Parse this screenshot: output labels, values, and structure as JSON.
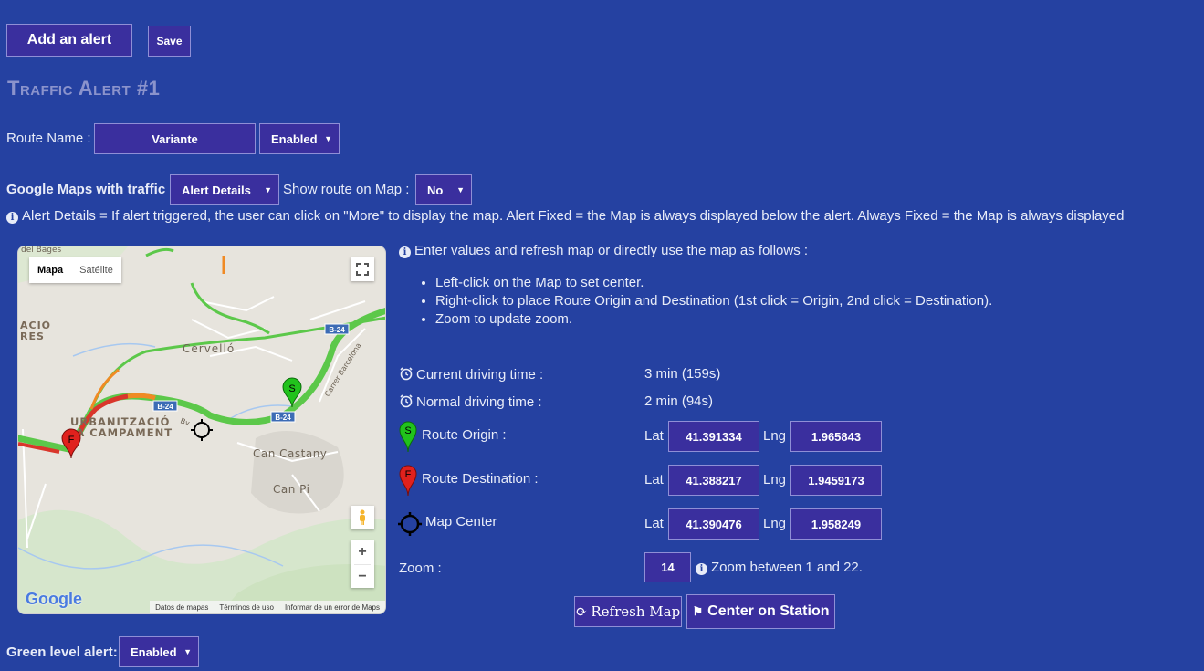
{
  "toolbar": {
    "add_alert_label": "Add an alert",
    "save_label": "Save"
  },
  "alert": {
    "title": "Traffic Alert #1",
    "route_name_label": "Route Name :",
    "route_name_value": "Variante",
    "route_status": "Enabled",
    "maps_label": "Google Maps with traffic :",
    "maps_mode": "Alert Details",
    "show_route_label": "Show route on Map :",
    "show_route_value": "No",
    "maps_info": "Alert Details = If alert triggered, the user can click on \"More\" to display the map. Alert Fixed = the Map is always displayed below the alert. Always Fixed = the Map is always displayed"
  },
  "map": {
    "type_map": "Mapa",
    "type_satellite": "Satélite",
    "place_labels": [
      "Cervelló",
      "URBANITZACIÓ",
      "LA CAMPAMENT",
      "Can Castany",
      "Can Pi",
      "ACIÓ",
      "RES",
      "del Bages",
      "Carrer Barcelona",
      "Bv"
    ],
    "road_badges": [
      "B-24",
      "B-24",
      "B-24"
    ],
    "footer": [
      "Datos de mapas",
      "Términos de uso",
      "Informar de un error de Maps"
    ],
    "brand": "Google",
    "zoom_in": "+",
    "zoom_out": "−"
  },
  "instructions": {
    "intro": "Enter values and refresh map or directly use the map as follows :",
    "items": [
      "Left-click on the Map to set center.",
      "Right-click to place Route Origin and Destination (1st click = Origin, 2nd click = Destination).",
      "Zoom to update zoom."
    ]
  },
  "details": {
    "current_label": "Current driving time :",
    "current_value": "3 min (159s)",
    "normal_label": "Normal driving time :",
    "normal_value": "2 min (94s)",
    "origin_label": "Route Origin :",
    "destination_label": "Route Destination :",
    "center_label": "Map Center",
    "lat_label": "Lat",
    "lng_label": "Lng",
    "origin_lat": "41.391334",
    "origin_lng": "1.965843",
    "destination_lat": "41.388217",
    "destination_lng": "1.9459173",
    "center_lat": "41.390476",
    "center_lng": "1.958249",
    "zoom_label": "Zoom :",
    "zoom_value": "14",
    "zoom_info": "Zoom between 1 and 22.",
    "refresh_label": "Refresh Map",
    "center_station_label": "Center on Station"
  },
  "green_alert": {
    "label": "Green level alert:",
    "value": "Enabled"
  },
  "colors": {
    "background": "#2541a1",
    "control": "#3a2f9e",
    "title": "#8b93cc",
    "origin_pin": "#21c21c",
    "destination_pin": "#e0211d"
  },
  "icons": [
    "info-icon",
    "alarm-clock-icon",
    "origin-pin-icon",
    "destination-pin-icon",
    "crosshair-icon",
    "refresh-icon",
    "station-icon",
    "fullscreen-icon",
    "pegman-icon"
  ]
}
